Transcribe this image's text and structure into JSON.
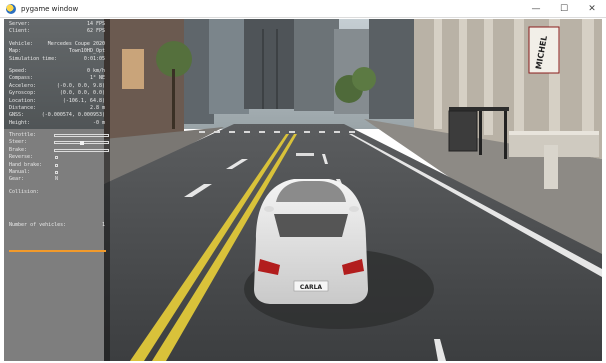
{
  "window": {
    "title": "pygame window",
    "controls": {
      "minimize": "—",
      "maximize": "☐",
      "close": "✕"
    }
  },
  "hud": {
    "server": {
      "label": "Server:",
      "value": "14 FPS"
    },
    "client": {
      "label": "Client:",
      "value": "62 FPS"
    },
    "vehicle": {
      "label": "Vehicle:",
      "value": "Mercedes Coupe 2020"
    },
    "map": {
      "label": "Map:",
      "value": "Town10HD_Opt"
    },
    "sim_time": {
      "label": "Simulation time:",
      "value": "0:01:05"
    },
    "speed": {
      "label": "Speed:",
      "value": "0 km/h"
    },
    "compass": {
      "label": "Compass:",
      "value": "1° NE"
    },
    "accelero": {
      "label": "Accelero:",
      "value": "(-0.0, 0.0, 9.8)"
    },
    "gyroscop": {
      "label": "Gyroscop:",
      "value": "(0.0, 0.0, 0.0)"
    },
    "location": {
      "label": "Location:",
      "value": "(-106.1, 64.8)"
    },
    "distance": {
      "label": "Distance:",
      "value": "2.8 m"
    },
    "gnss": {
      "label": "GNSS:",
      "value": "(-0.000574, 0.000953)"
    },
    "height": {
      "label": "Height:",
      "value": "-0 m"
    },
    "throttle": {
      "label": "Throttle:",
      "level": 0
    },
    "steer": {
      "label": "Steer:",
      "level": 0.5
    },
    "brake": {
      "label": "Brake:",
      "level": 0
    },
    "reverse": {
      "label": "Reverse:"
    },
    "hand_brake": {
      "label": "Hand brake:"
    },
    "manual": {
      "label": "Manual:"
    },
    "gear": {
      "label": "Gear:",
      "value": "N"
    },
    "collision": {
      "label": "Collision:"
    },
    "vehicles": {
      "label": "Number of vehicles:",
      "value": "1"
    }
  },
  "scene": {
    "banner_text": "MICHEL",
    "plate_text": "CARLA",
    "colors": {
      "asphalt": "#4a4c4e",
      "lane_yellow": "#d9c23a",
      "car_white": "#e9e9e9",
      "sky": "#b9c3c9"
    }
  }
}
